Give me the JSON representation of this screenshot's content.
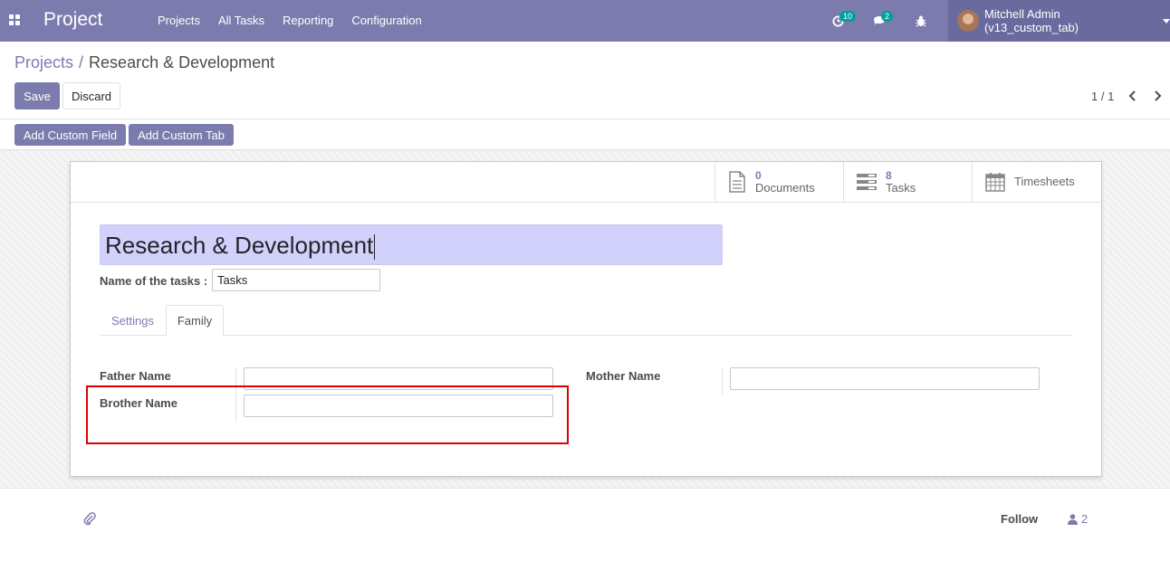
{
  "navbar": {
    "brand": "Project",
    "menu": [
      "Projects",
      "All Tasks",
      "Reporting",
      "Configuration"
    ],
    "activity_count": "10",
    "messages_count": "2",
    "user_name": "Mitchell Admin (v13_custom_tab)"
  },
  "breadcrumb": {
    "parent": "Projects",
    "separator": "/",
    "current": "Research & Development"
  },
  "control": {
    "save_label": "Save",
    "discard_label": "Discard",
    "pager": "1 / 1",
    "add_custom_field": "Add Custom Field",
    "add_custom_tab": "Add Custom Tab"
  },
  "stats": {
    "documents_value": "0",
    "documents_label": "Documents",
    "tasks_value": "8",
    "tasks_label": "Tasks",
    "timesheets_label": "Timesheets"
  },
  "form": {
    "title": "Research & Development",
    "tasks_name_label": "Name of the tasks :",
    "tasks_name_value": "Tasks",
    "tabs": [
      "Settings",
      "Family"
    ],
    "active_tab": "Family",
    "father_label": "Father Name",
    "father_value": "",
    "brother_label": "Brother Name",
    "brother_value": "",
    "mother_label": "Mother Name",
    "mother_value": ""
  },
  "chatter": {
    "follow_label": "Follow",
    "followers_count": "2"
  },
  "colors": {
    "primary": "#7c7bad",
    "badge": "#00a09d",
    "highlight": "#e00000",
    "title_bg": "#d1d1fb"
  }
}
